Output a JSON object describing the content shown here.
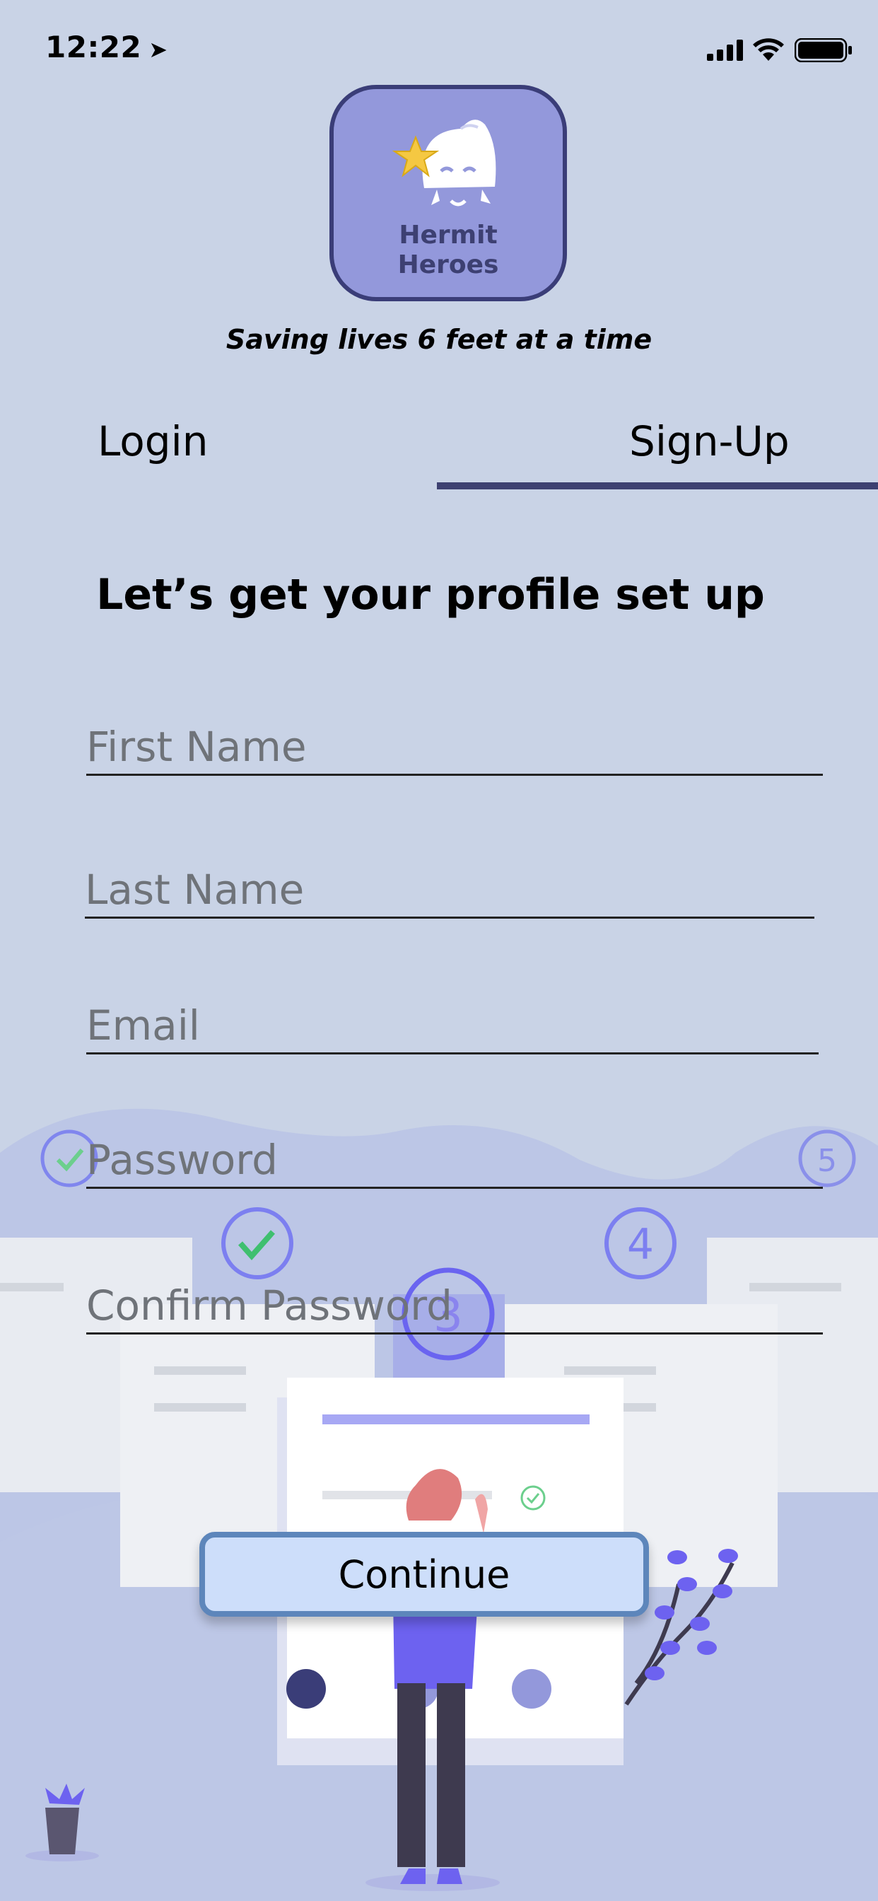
{
  "status_bar": {
    "time": "12:22"
  },
  "logo": {
    "line1": "Hermit",
    "line2": "Heroes"
  },
  "tagline": "Saving lives 6 feet at a time",
  "tabs": [
    {
      "label": "Login"
    },
    {
      "label": "Sign-Up"
    }
  ],
  "heading": "Let’s get your profile set up",
  "form": {
    "first_name": {
      "placeholder": "First Name",
      "value": ""
    },
    "last_name": {
      "placeholder": "Last Name",
      "value": ""
    },
    "email": {
      "placeholder": "Email",
      "value": ""
    },
    "password": {
      "placeholder": "Password",
      "value": ""
    },
    "confirm_password": {
      "placeholder": "Confirm Password",
      "value": ""
    }
  },
  "continue_label": "Continue",
  "illustration": {
    "steps": [
      "3",
      "4",
      "5"
    ]
  },
  "colors": {
    "background": "#c9d3e6",
    "accent": "#3d4071",
    "button": "#cddefa",
    "button_border": "#5d86bb"
  }
}
